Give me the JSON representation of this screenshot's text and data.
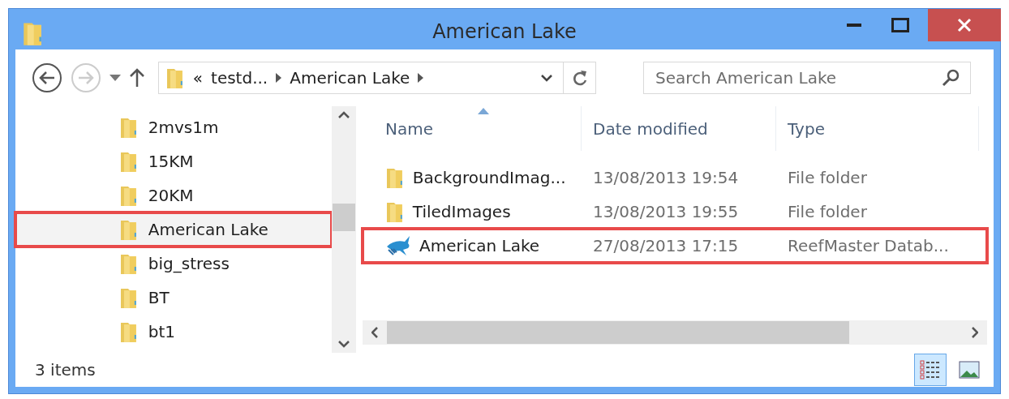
{
  "window": {
    "title": "American Lake"
  },
  "address": {
    "overflow": "«",
    "crumbs": [
      "testd...",
      "American Lake"
    ]
  },
  "search": {
    "placeholder": "Search American Lake"
  },
  "nav": {
    "items": [
      {
        "label": "2mvs1m",
        "selected": false,
        "outlined": false
      },
      {
        "label": "15KM",
        "selected": false,
        "outlined": false
      },
      {
        "label": "20KM",
        "selected": false,
        "outlined": false
      },
      {
        "label": "American Lake",
        "selected": true,
        "outlined": true
      },
      {
        "label": "big_stress",
        "selected": false,
        "outlined": false
      },
      {
        "label": "BT",
        "selected": false,
        "outlined": false
      },
      {
        "label": "bt1",
        "selected": false,
        "outlined": false
      }
    ]
  },
  "table": {
    "columns": [
      {
        "label": "Name",
        "sorted": true
      },
      {
        "label": "Date modified",
        "sorted": false
      },
      {
        "label": "Type",
        "sorted": false
      }
    ],
    "rows": [
      {
        "kind": "folder",
        "name": "BackgroundImag...",
        "date": "13/08/2013 19:54",
        "type": "File folder",
        "outlined": false
      },
      {
        "kind": "folder",
        "name": "TiledImages",
        "date": "13/08/2013 19:55",
        "type": "File folder",
        "outlined": false
      },
      {
        "kind": "database",
        "name": "American Lake",
        "date": "27/08/2013 17:15",
        "type": "ReefMaster Datab...",
        "outlined": true
      }
    ]
  },
  "status_bar": {
    "count": "3 items",
    "views": [
      {
        "kind": "details",
        "selected": true
      },
      {
        "kind": "large-icons",
        "selected": false
      }
    ]
  }
}
